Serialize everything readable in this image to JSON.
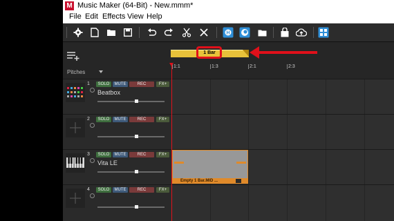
{
  "window": {
    "title": "Music Maker (64-Bit) - New.mmm*",
    "logo_letter": "M"
  },
  "menu": [
    "File",
    "Edit",
    "Effects",
    "View",
    "Help"
  ],
  "toolbar": {
    "icons": [
      "settings-icon",
      "new-file-icon",
      "open-folder-icon",
      "save-icon",
      "undo-icon",
      "redo-icon",
      "cut-icon",
      "delete-icon",
      "soundpool-icon",
      "store-icon",
      "folder-icon",
      "shop-bag-icon",
      "cloud-upload-icon",
      "grid-view-icon"
    ]
  },
  "arranger": {
    "pitches_label": "Pitches",
    "loop_label": "1 Bar",
    "ruler": [
      "1:1",
      "1:3",
      "2:1",
      "2:3"
    ]
  },
  "tracks": [
    {
      "number": "1",
      "name": "Beatbox",
      "solo": "SOLO",
      "mute": "MUTE",
      "rec": "REC",
      "fx": "FX+"
    },
    {
      "number": "2",
      "name": "",
      "solo": "SOLO",
      "mute": "MUTE",
      "rec": "REC",
      "fx": "FX+"
    },
    {
      "number": "3",
      "name": "Vita LE",
      "solo": "SOLO",
      "mute": "MUTE",
      "rec": "REC",
      "fx": "FX+"
    },
    {
      "number": "4",
      "name": "",
      "solo": "SOLO",
      "mute": "MUTE",
      "rec": "REC",
      "fx": "FX+"
    }
  ],
  "clip": {
    "label": "Empty 1 Bar.MID ..."
  },
  "colors": {
    "accent_red": "#e0101a",
    "loop_yellow": "#e8c23a",
    "clip_orange": "#e08a2a"
  }
}
